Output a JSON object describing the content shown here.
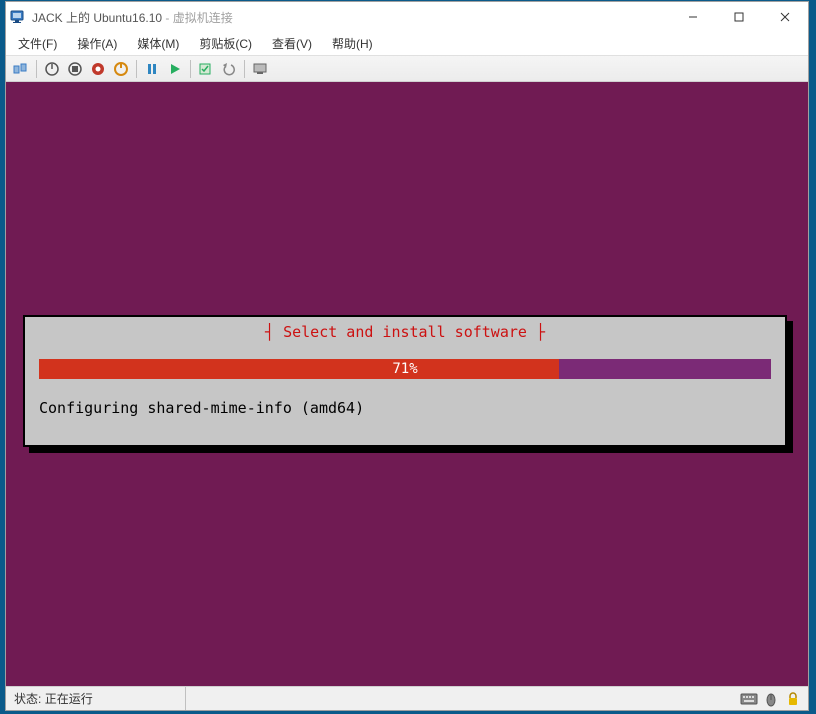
{
  "titlebar": {
    "vm_name": "JACK 上的 Ubuntu16.10",
    "suffix": " - 虚拟机连接"
  },
  "menubar": {
    "file": "文件(F)",
    "action": "操作(A)",
    "media": "媒体(M)",
    "clipboard": "剪贴板(C)",
    "view": "查看(V)",
    "help": "帮助(H)"
  },
  "toolbar_icons": {
    "ctrlaltdel": "ctrl-alt-del-icon",
    "turnoff": "turn-off-icon",
    "shutdown": "shut-down-icon",
    "reset": "reset-icon",
    "power": "power-icon",
    "pause": "pause-icon",
    "start": "start-icon",
    "checkpoint": "checkpoint-icon",
    "revert": "revert-icon",
    "enhanced": "enhanced-session-icon"
  },
  "installer": {
    "title": "┤ Select and install software ├",
    "progress_percent": 71,
    "progress_label": "71%",
    "status_text": "Configuring shared-mime-info (amd64)"
  },
  "statusbar": {
    "label_prefix": "状态:",
    "status_text": "正在运行"
  },
  "chart_data": {
    "type": "bar",
    "title": "Select and install software",
    "categories": [
      "progress"
    ],
    "values": [
      71
    ],
    "ylim": [
      0,
      100
    ],
    "xlabel": "",
    "ylabel": "percent",
    "annotations": [
      "Configuring shared-mime-info (amd64)"
    ]
  }
}
